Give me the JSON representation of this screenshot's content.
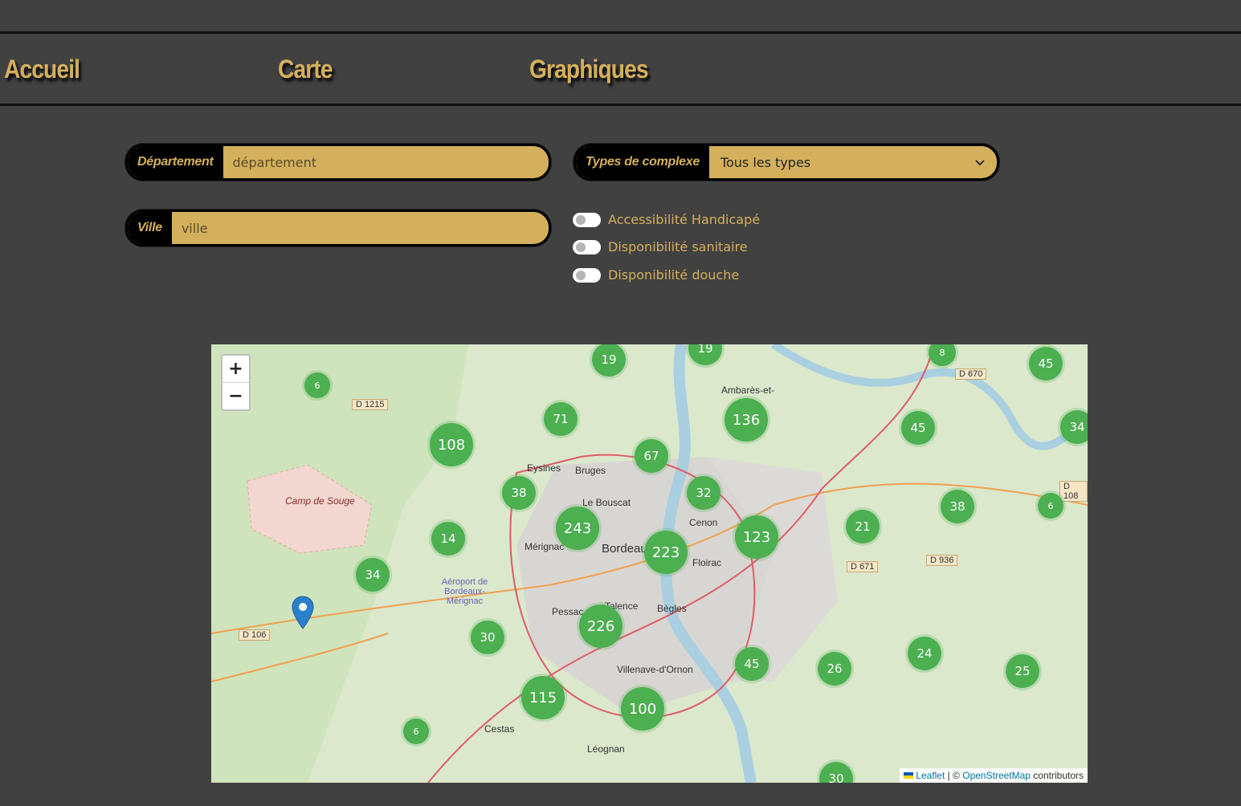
{
  "nav": {
    "home": "Accueil",
    "map": "Carte",
    "charts": "Graphiques"
  },
  "filters": {
    "department": {
      "label": "Département",
      "placeholder": "département"
    },
    "city": {
      "label": "Ville",
      "placeholder": "ville"
    },
    "complex_type": {
      "label": "Types de complexe",
      "selected": "Tous les types"
    },
    "toggles": [
      {
        "label": "Accessibilité Handicapé",
        "on": false
      },
      {
        "label": "Disponibilité sanitaire",
        "on": false
      },
      {
        "label": "Disponibilité douche",
        "on": false
      }
    ]
  },
  "map": {
    "zoom_in": "+",
    "zoom_out": "−",
    "attribution": {
      "leaflet": "Leaflet",
      "sep": " | © ",
      "osm": "OpenStreetMap",
      "rest": " contributors"
    },
    "clusters": [
      "19",
      "19",
      "8",
      "45",
      "6",
      "71",
      "136",
      "45",
      "34",
      "108",
      "67",
      "38",
      "32",
      "38",
      "6",
      "14",
      "243",
      "223",
      "123",
      "21",
      "34",
      "30",
      "226",
      "45",
      "26",
      "24",
      "25",
      "115",
      "100",
      "6",
      "30"
    ],
    "places": [
      "Camp de Souge",
      "Eysines",
      "Bruges",
      "Le Bouscat",
      "Mérignac",
      "Bordeaux",
      "Cenon",
      "Floirac",
      "Pessac",
      "Talence",
      "Bègles",
      "Villenave-d'Ornon",
      "Cestas",
      "Léognan",
      "Ambarès-et-",
      "Aéroport de Bordeaux-Mérignac"
    ],
    "roads": [
      "D 1215",
      "D 106",
      "D 670",
      "D 671",
      "D 936",
      "D 108"
    ]
  },
  "colors": {
    "accent": "#d4b05c",
    "background": "#414141",
    "cluster": "#4caf50"
  }
}
